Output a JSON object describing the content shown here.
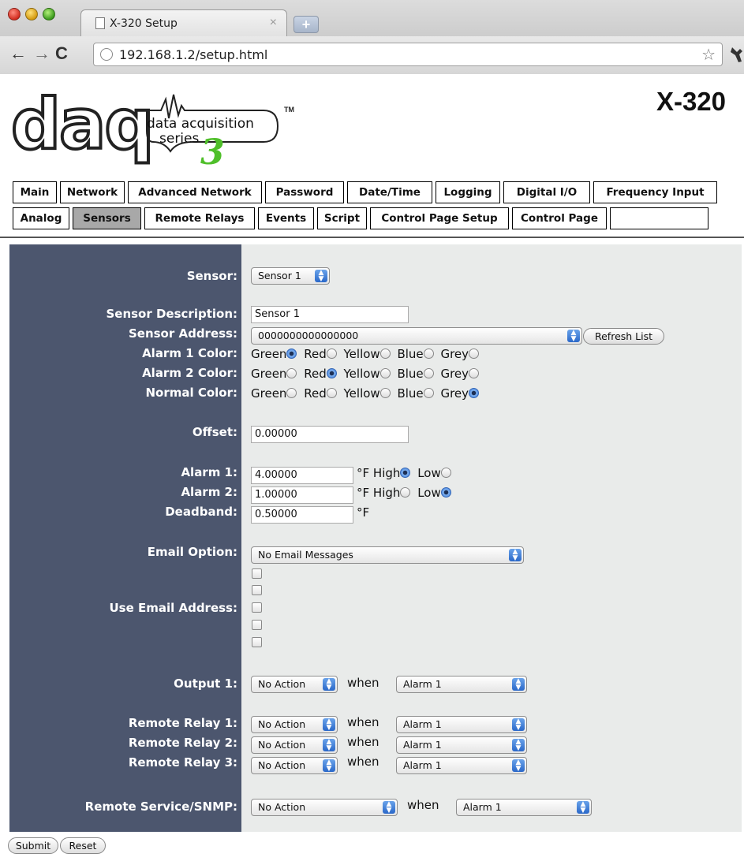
{
  "browser": {
    "tab_title": "X-320 Setup",
    "tab_close": "×",
    "new_tab": "+",
    "url": "192.168.1.2/setup.html",
    "back": "←",
    "forward": "→",
    "reload": "C",
    "star": "☆",
    "wrench": "🔧"
  },
  "header": {
    "logo_text": "daq",
    "logo_tagline_1": "data acquisition",
    "logo_tagline_2": "series",
    "logo_tm": "TM",
    "logo_number": "3",
    "model": "X-320"
  },
  "nav": {
    "row1": [
      "Main",
      "Network",
      "Advanced Network",
      "Password",
      "Date/Time",
      "Logging",
      "Digital I/O",
      "Frequency Input"
    ],
    "row2": [
      "Analog",
      "Sensors",
      "Remote Relays",
      "Events",
      "Script",
      "Control Page Setup",
      "Control Page"
    ],
    "active": "Sensors"
  },
  "form": {
    "sensor": {
      "label": "Sensor:",
      "value": "Sensor 1"
    },
    "description": {
      "label": "Sensor Description:",
      "value": "Sensor 1"
    },
    "address": {
      "label": "Sensor Address:",
      "value": "0000000000000000",
      "refresh": "Refresh List"
    },
    "alarm1_color": {
      "label": "Alarm 1 Color:",
      "selected": "Green"
    },
    "alarm2_color": {
      "label": "Alarm 2 Color:",
      "selected": "Red"
    },
    "normal_color": {
      "label": "Normal Color:",
      "selected": "Grey"
    },
    "color_options": [
      "Green",
      "Red",
      "Yellow",
      "Blue",
      "Grey"
    ],
    "offset": {
      "label": "Offset:",
      "value": "0.00000"
    },
    "alarm1": {
      "label": "Alarm 1:",
      "value": "4.00000",
      "unit": "°F",
      "selected": "High"
    },
    "alarm2": {
      "label": "Alarm 2:",
      "value": "1.00000",
      "unit": "°F",
      "selected": "Low"
    },
    "deadband": {
      "label": "Deadband:",
      "value": "0.50000",
      "unit": "°F"
    },
    "high_low": [
      "High",
      "Low"
    ],
    "email_option": {
      "label": "Email Option:",
      "value": "No Email Messages"
    },
    "use_email": {
      "label": "Use Email Address:",
      "count": 5
    },
    "output1": {
      "label": "Output 1:",
      "action": "No Action",
      "when": "when",
      "condition": "Alarm 1"
    },
    "remote_relay1": {
      "label": "Remote Relay 1:",
      "action": "No Action",
      "when": "when",
      "condition": "Alarm 1"
    },
    "remote_relay2": {
      "label": "Remote Relay 2:",
      "action": "No Action",
      "when": "when",
      "condition": "Alarm 1"
    },
    "remote_relay3": {
      "label": "Remote Relay 3:",
      "action": "No Action",
      "when": "when",
      "condition": "Alarm 1"
    },
    "remote_service": {
      "label": "Remote Service/SNMP:",
      "action": "No Action",
      "when": "when",
      "condition": "Alarm 1"
    }
  },
  "buttons": {
    "submit": "Submit",
    "reset": "Reset"
  },
  "colors": {
    "label_panel": "#4c566e",
    "form_panel": "#e9ebea",
    "active_tab": "#a8a8a8",
    "logo_green": "#4fbf2a"
  }
}
